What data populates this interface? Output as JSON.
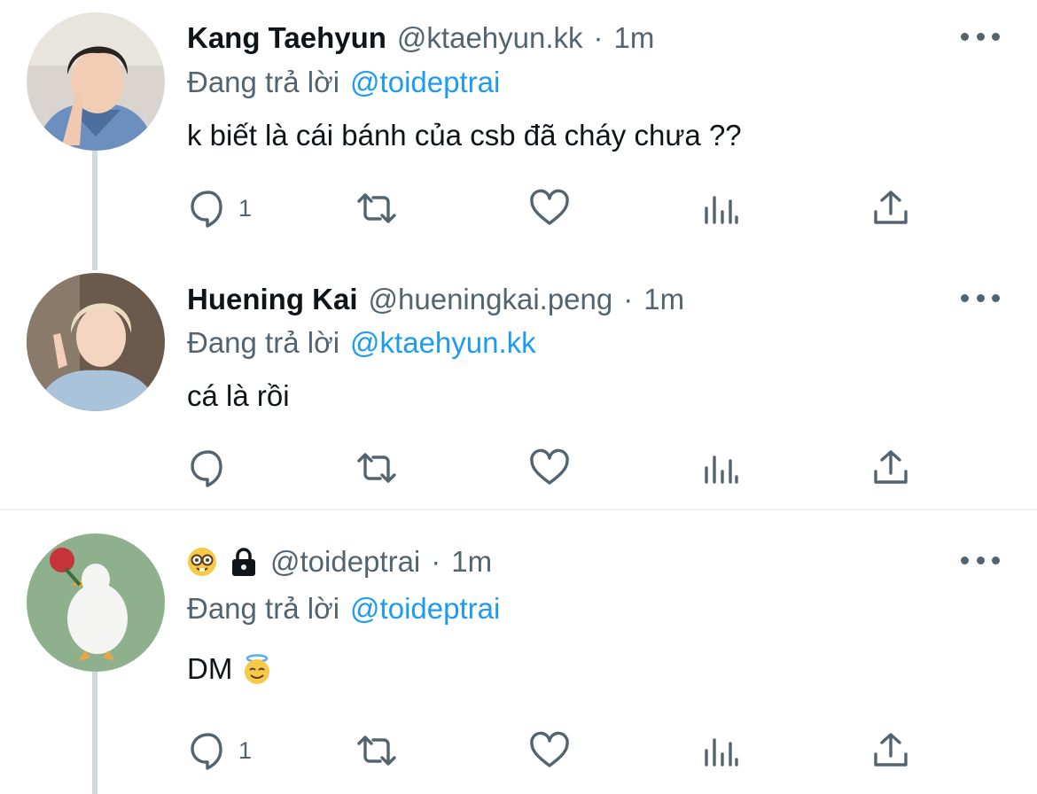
{
  "tweets": [
    {
      "display_name": "Kang Taehyun",
      "handle": "@ktaehyun.kk",
      "separator": "·",
      "time": "1m",
      "replying_prefix": "Đang trả lời",
      "replying_to": "@toideptrai",
      "text": "k biết là cái bánh của csb đã cháy chưa ??",
      "reply_count": "1"
    },
    {
      "display_name": "Huening Kai",
      "handle": "@hueningkai.peng",
      "separator": "·",
      "time": "1m",
      "replying_prefix": "Đang trả lời",
      "replying_to": "@ktaehyun.kk",
      "text": "cá là rồi",
      "reply_count": ""
    },
    {
      "display_name": "",
      "handle": "@toideptrai",
      "separator": "·",
      "time": "1m",
      "replying_prefix": "Đang trả lời",
      "replying_to": "@toideptrai",
      "text": "DM",
      "reply_count": "1",
      "name_icons": [
        "nerd-face-icon",
        "lock-icon"
      ],
      "text_icon": "smiling-face-with-halo-icon"
    }
  ],
  "colors": {
    "link": "#1d9bf0",
    "secondary": "#536471",
    "primary_text": "#0f1419",
    "thread_line": "#cfd9de"
  },
  "action_icons": [
    "reply-icon",
    "retweet-icon",
    "like-icon",
    "views-icon",
    "share-icon"
  ]
}
